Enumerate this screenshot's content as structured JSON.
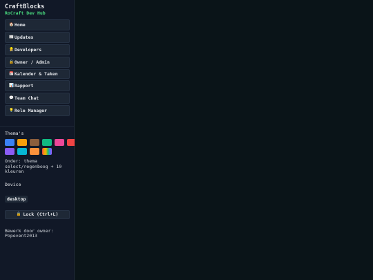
{
  "app": {
    "title": "CraftBlocks",
    "subtitle": "RoCraft Dev Hub"
  },
  "nav": [
    {
      "icon": "home-icon",
      "glyph": "🏠",
      "label": "Home"
    },
    {
      "icon": "newspaper-icon",
      "glyph": "📰",
      "label": "Updates"
    },
    {
      "icon": "developer-icon",
      "glyph": "👷",
      "label": "Developers"
    },
    {
      "icon": "lock-icon",
      "glyph": "🔒",
      "label": "Owner / Admin"
    },
    {
      "icon": "calendar-icon",
      "glyph": "📅",
      "label": "Kalender & Taken"
    },
    {
      "icon": "report-icon",
      "glyph": "📊",
      "label": "Rapport"
    },
    {
      "icon": "chat-icon",
      "glyph": "💬",
      "label": "Team Chat"
    },
    {
      "icon": "bulb-icon",
      "glyph": "💡",
      "label": "Role Manager"
    }
  ],
  "themes": {
    "label": "Thema's",
    "colors": [
      "#3b82f6",
      "#f59e0b",
      "#8b5e3c",
      "#10b981",
      "#ec4899",
      "#ef4444",
      "#8b5cf6",
      "#06b6d4",
      "#fb923c",
      "rainbow"
    ],
    "note": "Onder: thema select/regenboog + 10 kleuren"
  },
  "device": {
    "label": "Device",
    "value": "desktop"
  },
  "lock": {
    "glyph": "🔒",
    "label": "Lock (Ctrl+L)"
  },
  "owner_note": "Bewerk door owner: Popevent2013"
}
